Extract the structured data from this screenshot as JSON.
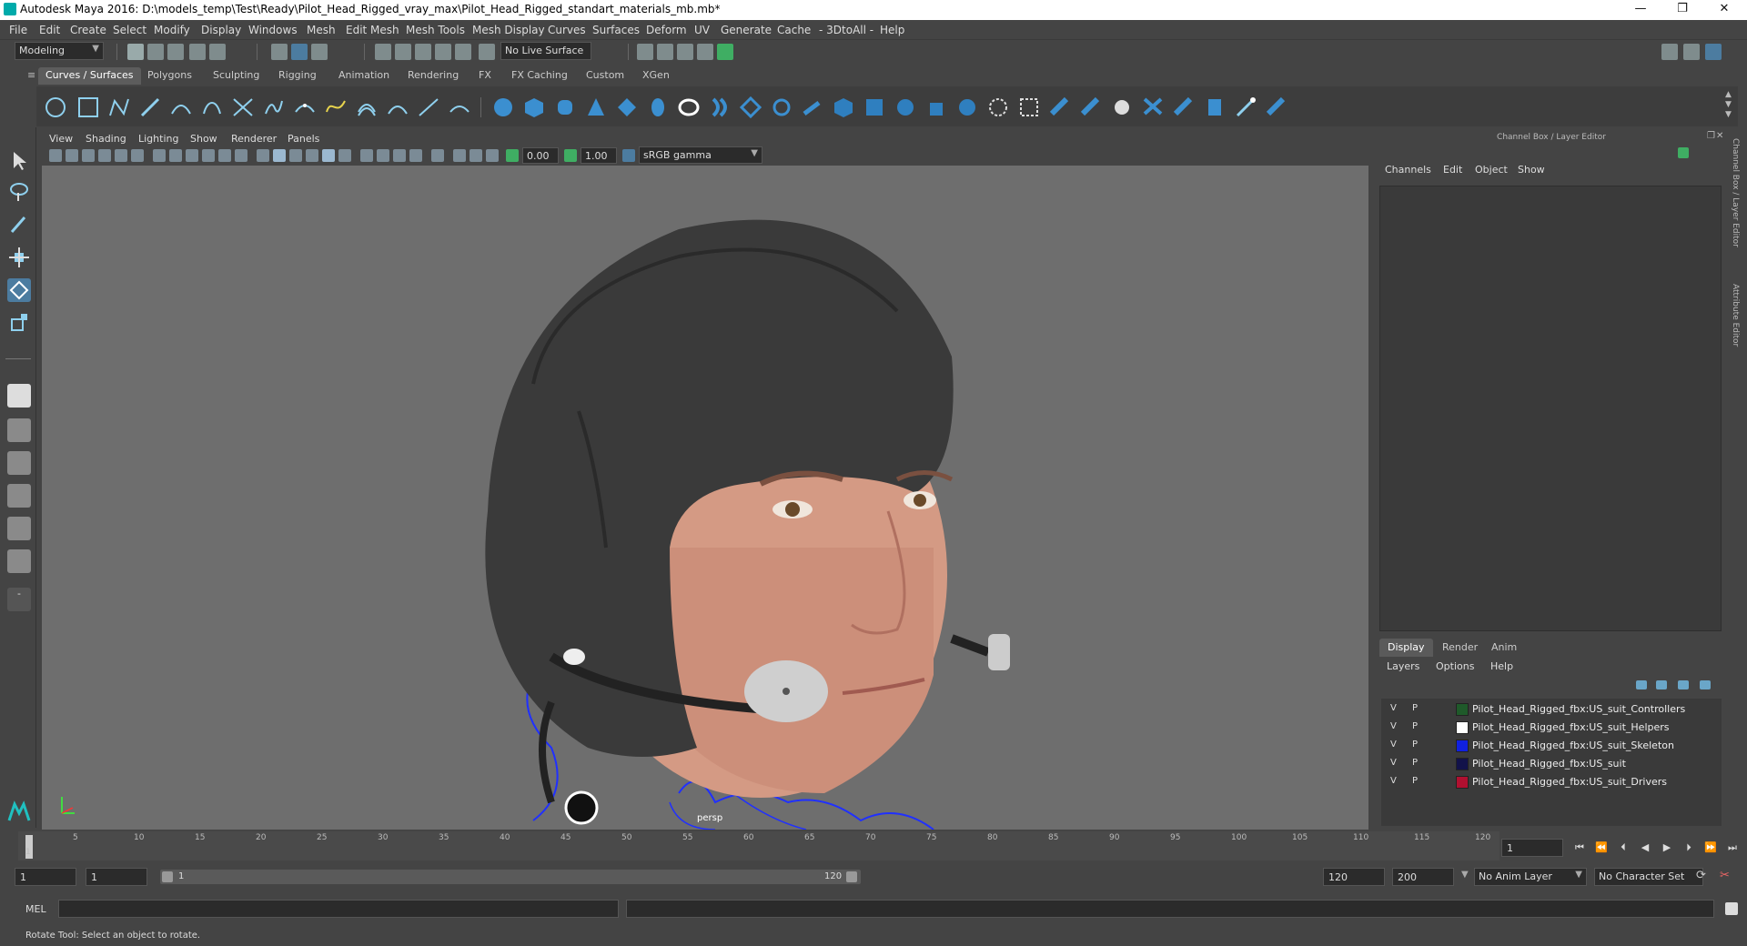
{
  "window": {
    "title": "Autodesk Maya 2016: D:\\models_temp\\Test\\Ready\\Pilot_Head_Rigged_vray_max\\Pilot_Head_Rigged_standart_materials_mb.mb*",
    "minimize": "—",
    "maximize": "❐",
    "close": "✕"
  },
  "menus": [
    "File",
    "Edit",
    "Create",
    "Select",
    "Modify",
    "Display",
    "Windows",
    "Mesh",
    "Edit Mesh",
    "Mesh Tools",
    "Mesh Display",
    "Curves",
    "Surfaces",
    "Deform",
    "UV",
    "Generate",
    "Cache",
    "- 3DtoAll -",
    "Help"
  ],
  "status": {
    "mode": "Modeling",
    "live_surface": "No Live Surface"
  },
  "shelf_tabs": [
    "Curves / Surfaces",
    "Polygons",
    "Sculpting",
    "Rigging",
    "Animation",
    "Rendering",
    "FX",
    "FX Caching",
    "Custom",
    "XGen"
  ],
  "viewport": {
    "menus": [
      "View",
      "Shading",
      "Lighting",
      "Show",
      "Renderer",
      "Panels"
    ],
    "exposure": "0.00",
    "gamma": "1.00",
    "color_space": "sRGB gamma",
    "camera_label": "persp"
  },
  "channel_box": {
    "title": "Channel Box / Layer Editor",
    "menus": [
      "Channels",
      "Edit",
      "Object",
      "Show"
    ],
    "side_tabs": [
      "Channel Box / Layer Editor",
      "Attribute Editor"
    ]
  },
  "layer_editor": {
    "tabs": [
      "Display",
      "Render",
      "Anim"
    ],
    "menus": [
      "Layers",
      "Options",
      "Help"
    ],
    "layers": [
      {
        "v": "V",
        "p": "P",
        "color": "#1f5a2a",
        "name": "Pilot_Head_Rigged_fbx:US_suit_Controllers"
      },
      {
        "v": "V",
        "p": "P",
        "color": "#ffffff",
        "name": "Pilot_Head_Rigged_fbx:US_suit_Helpers"
      },
      {
        "v": "V",
        "p": "P",
        "color": "#1020e0",
        "name": "Pilot_Head_Rigged_fbx:US_suit_Skeleton"
      },
      {
        "v": "V",
        "p": "P",
        "color": "#12124a",
        "name": "Pilot_Head_Rigged_fbx:US_suit"
      },
      {
        "v": "V",
        "p": "P",
        "color": "#b01030",
        "name": "Pilot_Head_Rigged_fbx:US_suit_Drivers"
      }
    ]
  },
  "timeline": {
    "ticks": [
      "1",
      "5",
      "10",
      "15",
      "20",
      "25",
      "30",
      "35",
      "40",
      "45",
      "50",
      "55",
      "60",
      "65",
      "70",
      "75",
      "80",
      "85",
      "90",
      "95",
      "100",
      "105",
      "110",
      "115",
      "120"
    ],
    "current_frame": "1"
  },
  "range": {
    "start": "1",
    "start2": "1",
    "slider_start": "1",
    "slider_end": "120",
    "end": "120",
    "end2": "200",
    "anim_layer": "No Anim Layer",
    "character_set": "No Character Set"
  },
  "command": {
    "label": "MEL"
  },
  "help_line": "Rotate Tool: Select an object to rotate."
}
